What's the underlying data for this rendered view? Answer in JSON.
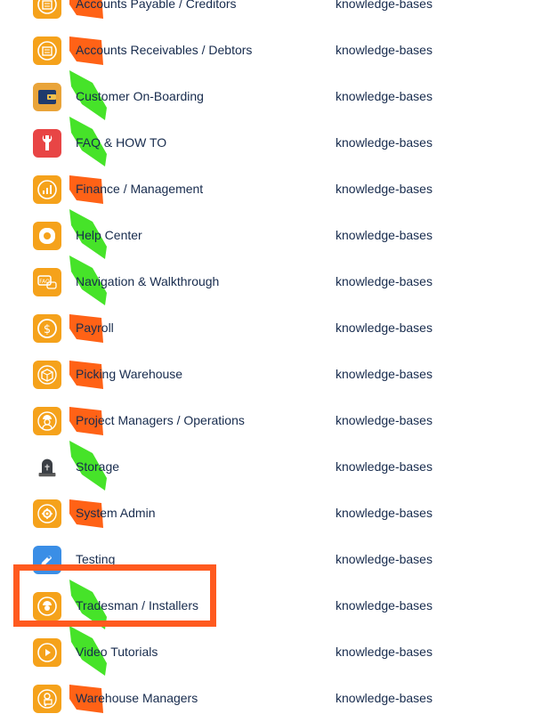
{
  "accent": "#ff5a1f",
  "rows": [
    {
      "name": "Accounts Payable / Creditors",
      "type": "knowledge-bases",
      "icon": "ledger-icon",
      "tile": "#f5a21b",
      "marker": "orange"
    },
    {
      "name": "Accounts Receivables / Debtors",
      "type": "knowledge-bases",
      "icon": "receipt-icon",
      "tile": "#f5a21b",
      "marker": "orange"
    },
    {
      "name": "Customer On-Boarding",
      "type": "knowledge-bases",
      "icon": "wallet-icon",
      "tile": "#e9a43a",
      "marker": "green"
    },
    {
      "name": "FAQ & HOW TO",
      "type": "knowledge-bases",
      "icon": "wrench-icon",
      "tile": "#e84545",
      "marker": "green"
    },
    {
      "name": "Finance / Management",
      "type": "knowledge-bases",
      "icon": "finance-chart-icon",
      "tile": "#f5a21b",
      "marker": "orange"
    },
    {
      "name": "Help Center",
      "type": "knowledge-bases",
      "icon": "help-lifebuoy-icon",
      "tile": "#f5a21b",
      "marker": "green"
    },
    {
      "name": "Navigation & Walkthrough",
      "type": "knowledge-bases",
      "icon": "faq-bubble-icon",
      "tile": "#f5a21b",
      "marker": "green"
    },
    {
      "name": "Payroll",
      "type": "knowledge-bases",
      "icon": "dollar-coin-icon",
      "tile": "#f5a21b",
      "marker": "orange"
    },
    {
      "name": "Picking Warehouse",
      "type": "knowledge-bases",
      "icon": "package-icon",
      "tile": "#f5a21b",
      "marker": "orange"
    },
    {
      "name": "Project Managers / Operations",
      "type": "knowledge-bases",
      "icon": "worker-icon",
      "tile": "#f5a21b",
      "marker": "orange"
    },
    {
      "name": "Storage",
      "type": "knowledge-bases",
      "icon": "tombstone-icon",
      "tile": "transparent",
      "marker": "green"
    },
    {
      "name": "System Admin",
      "type": "knowledge-bases",
      "icon": "admin-gear-icon",
      "tile": "#f5a21b",
      "marker": "orange"
    },
    {
      "name": "Testing",
      "type": "knowledge-bases",
      "icon": "rocket-icon",
      "tile": "#3a8ee6",
      "marker": "none"
    },
    {
      "name": "Tradesman / Installers",
      "type": "knowledge-bases",
      "icon": "tradesman-icon",
      "tile": "#f5a21b",
      "marker": "green"
    },
    {
      "name": "Video Tutorials",
      "type": "knowledge-bases",
      "icon": "play-icon",
      "tile": "#f5a21b",
      "marker": "green"
    },
    {
      "name": "Warehouse Managers",
      "type": "knowledge-bases",
      "icon": "forklift-worker-icon",
      "tile": "#f5a21b",
      "marker": "orange"
    }
  ]
}
